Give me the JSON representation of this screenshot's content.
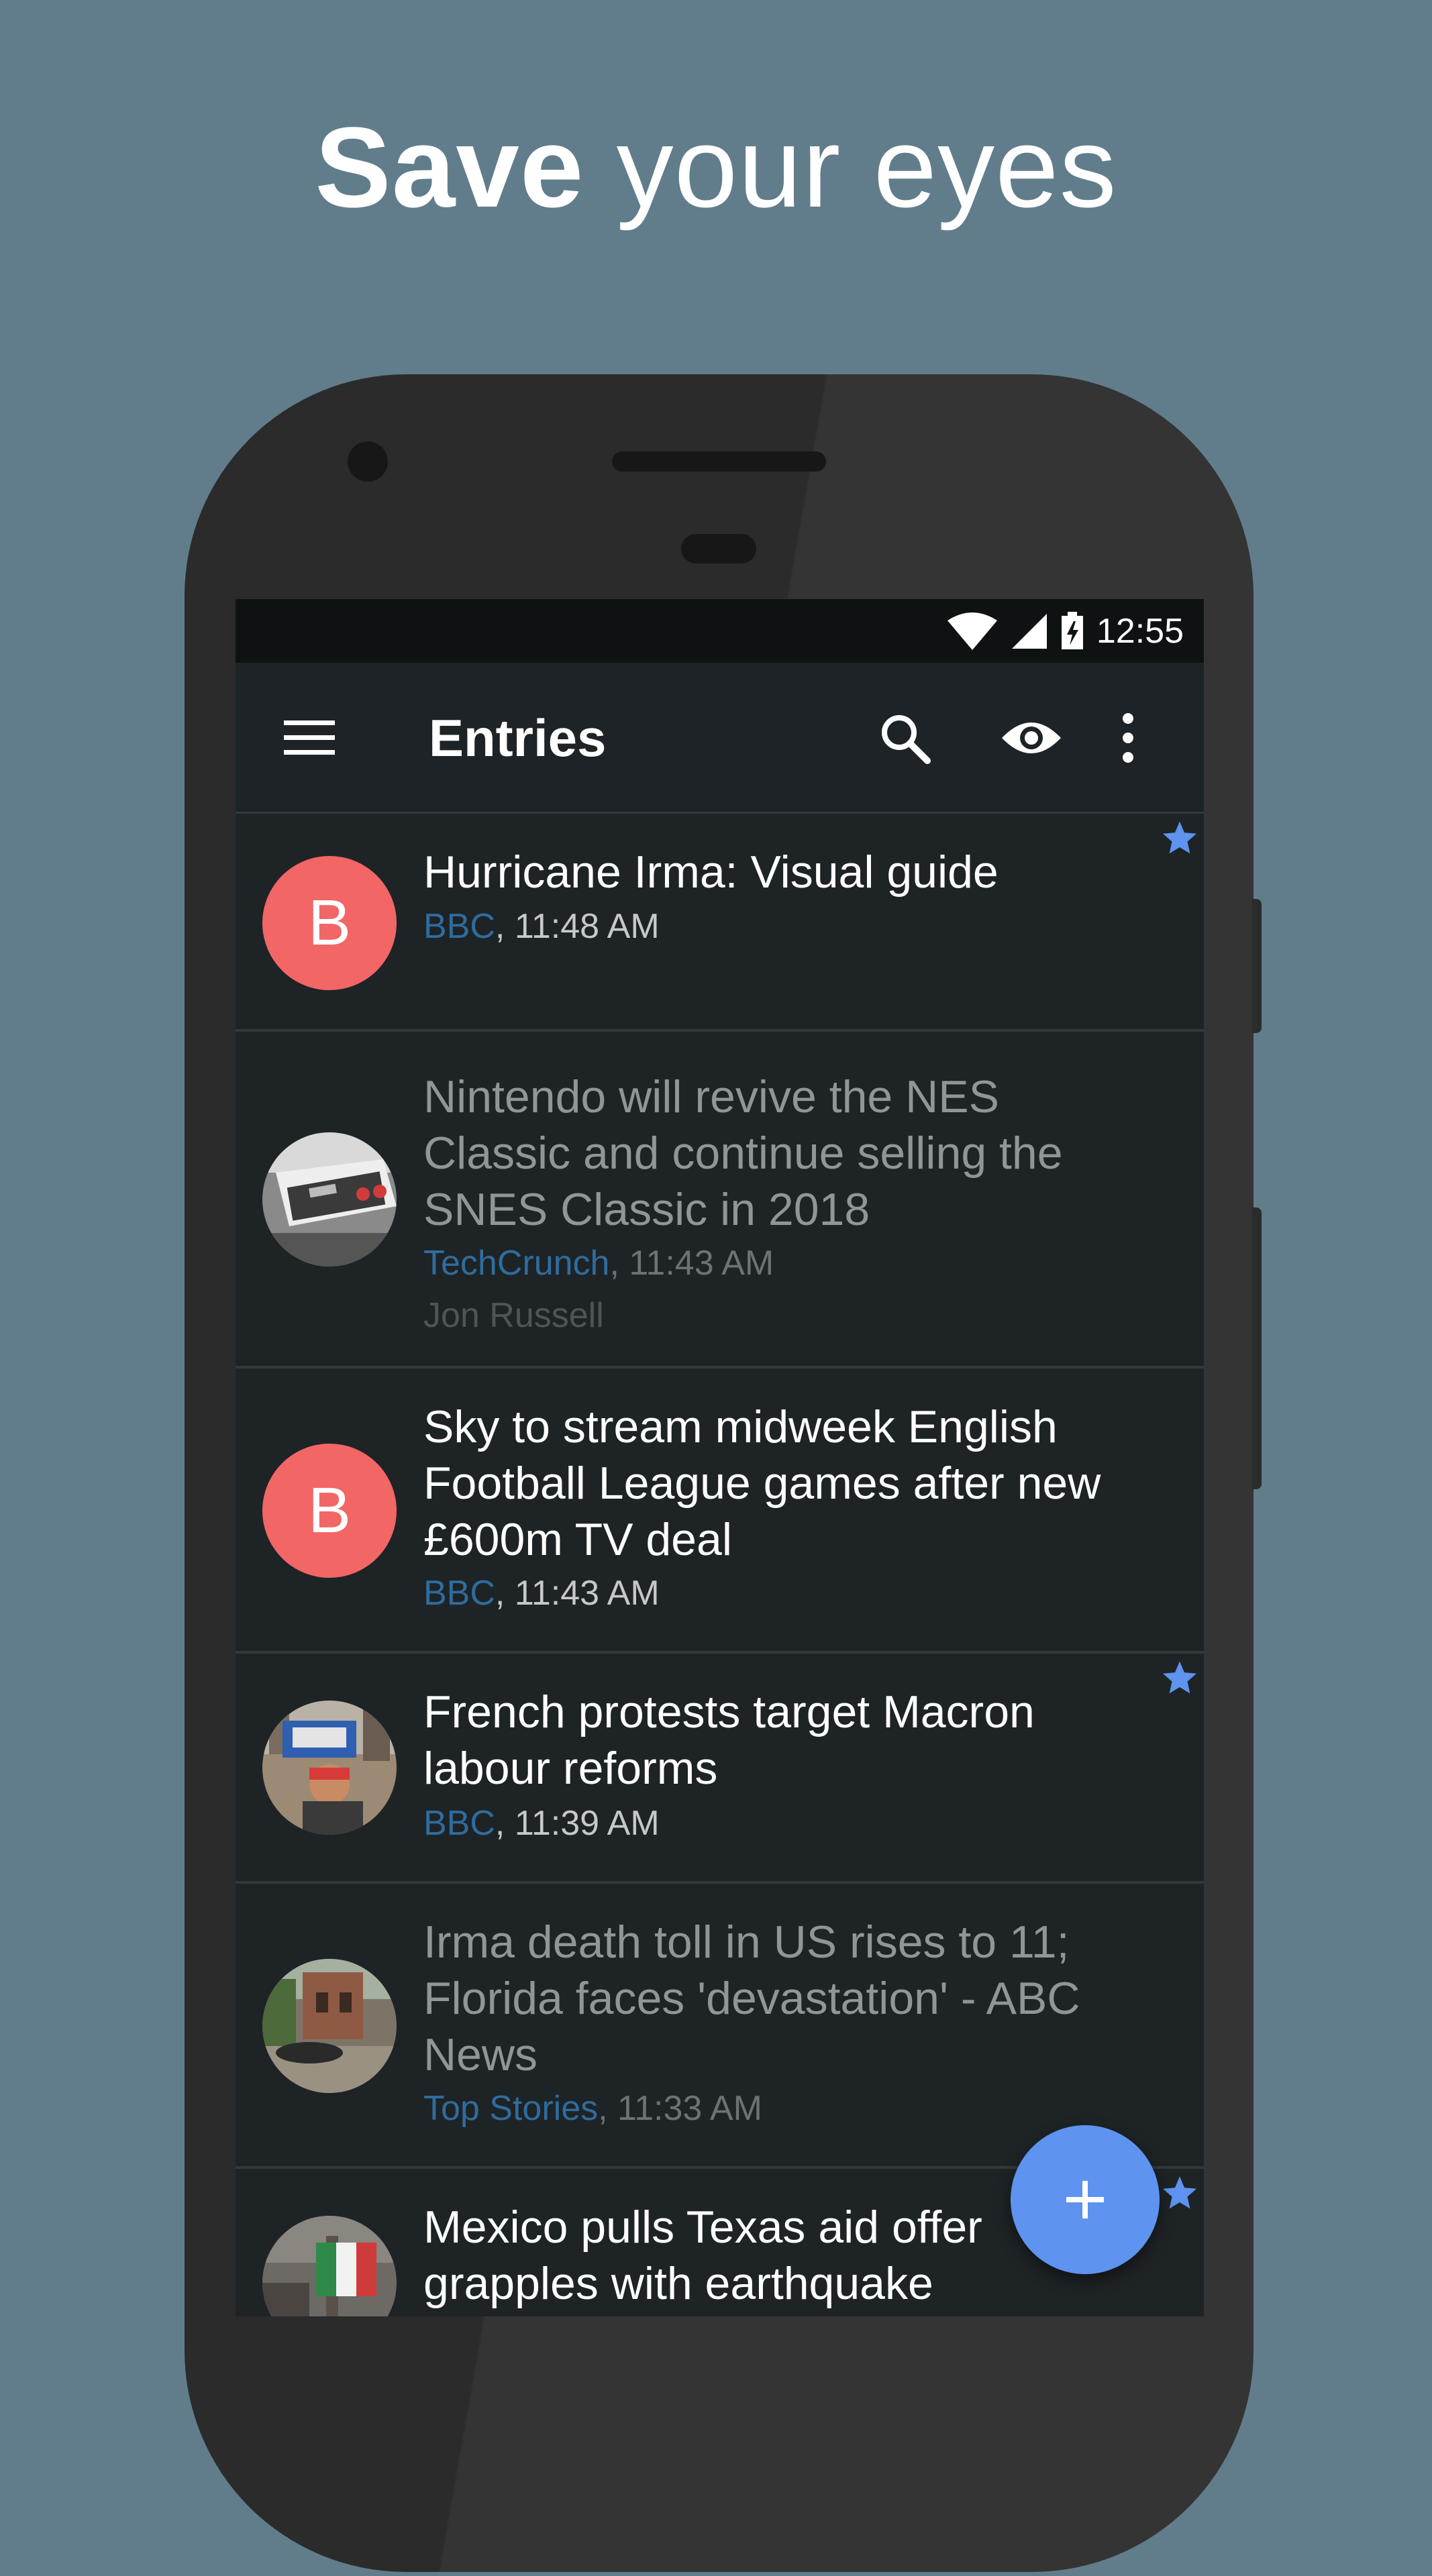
{
  "promo": {
    "headline_bold": "Save",
    "headline_light": "your eyes"
  },
  "status_bar": {
    "time": "12:55",
    "icons": [
      "wifi-icon",
      "signal-icon",
      "battery-icon"
    ]
  },
  "toolbar": {
    "title": "Entries",
    "icons": [
      "menu-icon",
      "search-icon",
      "eye-icon",
      "more-vert-icon"
    ]
  },
  "entries": [
    {
      "title": "Hurricane Irma: Visual guide",
      "source": "BBC",
      "time": ", 11:48 AM",
      "author": "",
      "avatar_letter": "B",
      "starred": true,
      "read": false
    },
    {
      "title": "Nintendo will revive the NES Classic and continue selling the SNES Classic in 2018",
      "source": "TechCrunch",
      "time": ", 11:43 AM",
      "author": "Jon Russell",
      "avatar_letter": "",
      "starred": false,
      "read": true
    },
    {
      "title": "Sky to stream midweek English Football League games after new £600m TV deal",
      "source": "BBC",
      "time": ", 11:43 AM",
      "author": "",
      "avatar_letter": "B",
      "starred": false,
      "read": false
    },
    {
      "title": "French protests target Macron labour reforms",
      "source": "BBC",
      "time": ", 11:39 AM",
      "author": "",
      "avatar_letter": "",
      "starred": true,
      "read": false
    },
    {
      "title": "Irma death toll in US rises to 11; Florida faces 'devastation' - ABC News",
      "source": "Top Stories",
      "time": ", 11:33 AM",
      "author": "",
      "avatar_letter": "",
      "starred": false,
      "read": true
    },
    {
      "title": "Mexico pulls Texas aid offer grapples with earthquake",
      "source": "",
      "time": "",
      "author": "",
      "avatar_letter": "",
      "starred": true,
      "read": false
    }
  ],
  "fab": {
    "icon": "plus-icon"
  },
  "colors": {
    "background": "#617d8b",
    "screen": "#1e2326",
    "accent": "#5e93f0",
    "avatar": "#f26666",
    "source_link": "#2f6c9e"
  }
}
